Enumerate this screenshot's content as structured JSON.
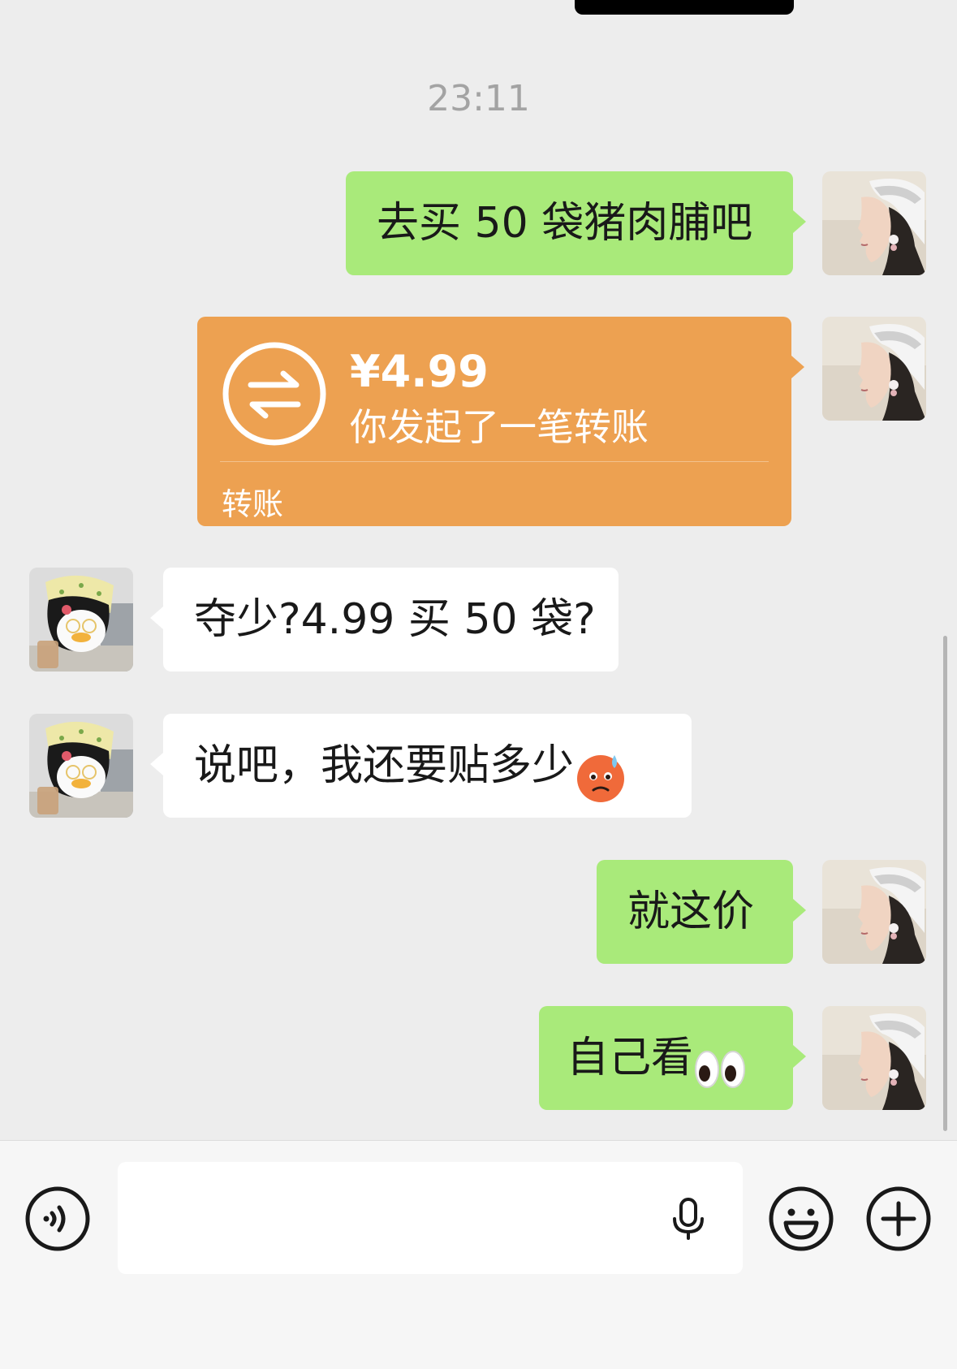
{
  "timestamp": "23:11",
  "messages": [
    {
      "sender": "me",
      "text": "去买 50 袋猪肉脯吧"
    },
    {
      "sender": "me",
      "type": "transfer",
      "amount": "¥4.99",
      "description": "你发起了一笔转账",
      "label": "转账"
    },
    {
      "sender": "them",
      "text": "夺少?4.99 买 50 袋?"
    },
    {
      "sender": "them",
      "text": "说吧，我还要贴多少",
      "emoji": "sweat-frown-emoji"
    },
    {
      "sender": "me",
      "text": "就这价"
    },
    {
      "sender": "me",
      "text": "自己看",
      "emoji": "eyes-emoji"
    }
  ],
  "input": {
    "value": "",
    "placeholder": ""
  },
  "icons": {
    "voice": "voice-toggle-icon",
    "mic": "microphone-icon",
    "emoji": "emoji-icon",
    "plus": "plus-icon"
  },
  "colors": {
    "background": "#ededed",
    "my_bubble": "#a9ea7a",
    "their_bubble": "#ffffff",
    "transfer": "#eda151",
    "timestamp": "#a3a3a3"
  }
}
